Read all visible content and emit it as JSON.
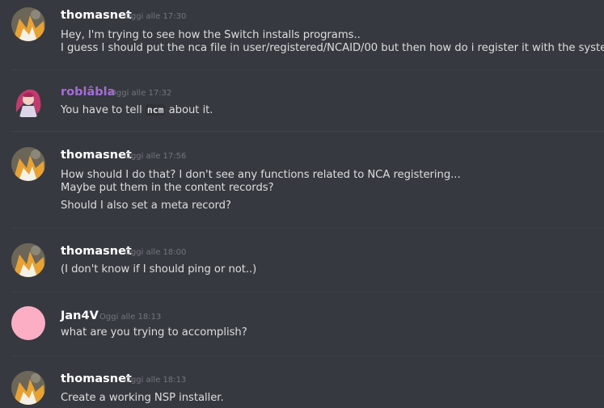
{
  "colors": {
    "background": "#36393f",
    "username_default": "#ffffff",
    "username_roblabla": "#a56bd6",
    "message_text": "#dcddde",
    "timestamp": "#72767d",
    "divider": "#3f4247",
    "jan4v_avatar": "#fcaec5"
  },
  "messages": [
    {
      "author": "thomasnet",
      "avatar_icon": "tails-avatar-icon",
      "timestamp": "Oggi alle 17:30",
      "lines": [
        "Hey, I'm trying to see how the Switch installs programs..",
        "I guess I should put the nca file in user/registered/NCAID/00 but then how do i register it with the system?"
      ]
    },
    {
      "author": "roblâbla",
      "avatar_icon": "anime-character-avatar-icon",
      "timestamp": "Oggi alle 17:32",
      "line_prefix": "You have to tell ",
      "code": "ncm",
      "line_suffix": " about it."
    },
    {
      "author": "thomasnet",
      "avatar_icon": "tails-avatar-icon",
      "timestamp": "Oggi alle 17:56",
      "lines": [
        "How should I do that? I don't see any functions related to NCA registering...",
        "Maybe put them in the content records?",
        "Should I also set a meta record?"
      ]
    },
    {
      "author": "thomasnet",
      "avatar_icon": "tails-avatar-icon",
      "timestamp": "Oggi alle 18:00",
      "lines": [
        "(I don't know if I should ping or not..)"
      ]
    },
    {
      "author": "Jan4V",
      "avatar_icon": "pink-circle-avatar-icon",
      "timestamp": "Oggi alle 18:13",
      "lines": [
        "what are you trying to accomplish?"
      ]
    },
    {
      "author": "thomasnet",
      "avatar_icon": "tails-avatar-icon",
      "timestamp": "Oggi alle 18:13",
      "lines": [
        "Create a working NSP installer."
      ]
    }
  ]
}
